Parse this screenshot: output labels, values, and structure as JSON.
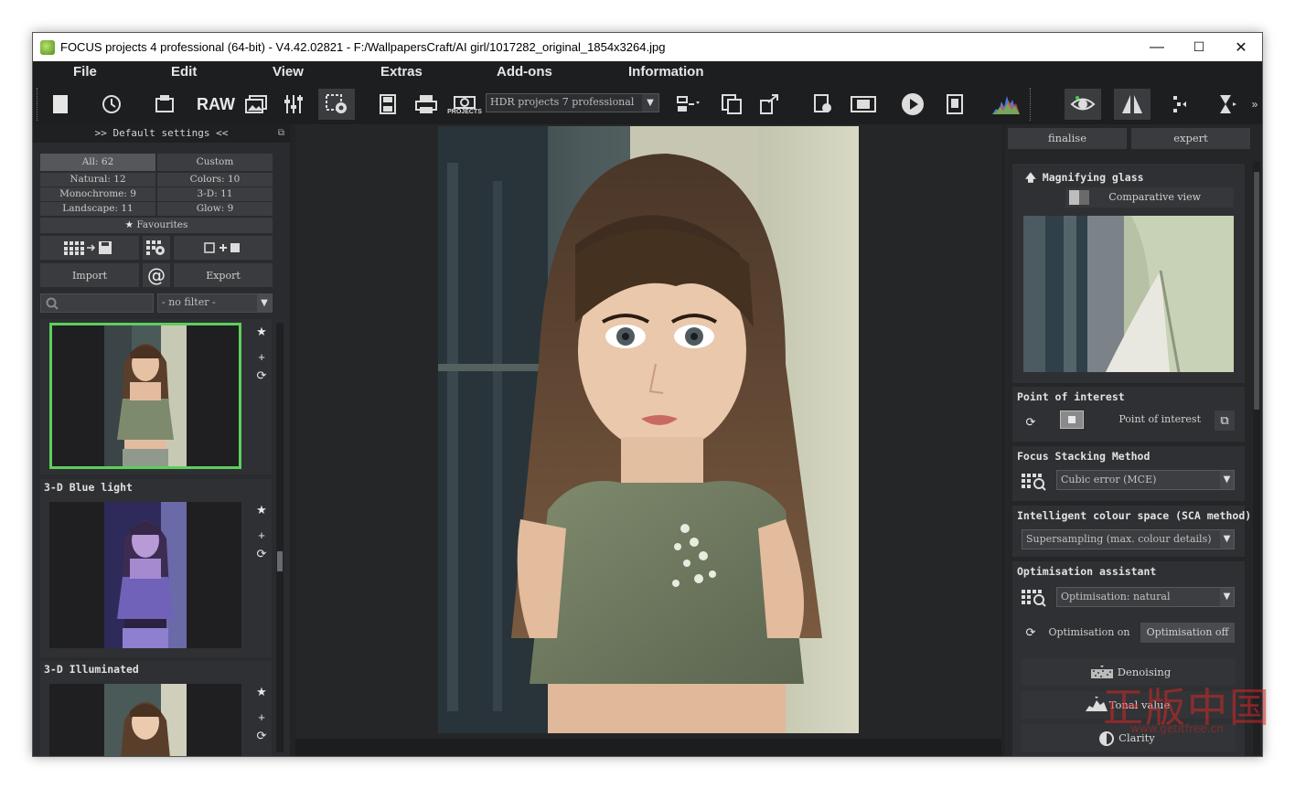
{
  "window": {
    "title": "FOCUS projects 4 professional (64-bit) - V4.42.02821 - F:/WallpapersCraft/AI girl/1017282_original_1854x3264.jpg",
    "minimize": "—",
    "maximize": "☐",
    "close": "✕"
  },
  "menu": [
    "File",
    "Edit",
    "View",
    "Extras",
    "Add-ons",
    "Information"
  ],
  "toolbar": {
    "raw_label": "RAW",
    "projects_label": "PROJECTS",
    "hdr_select": "HDR projects 7 professional",
    "more": "»"
  },
  "left_panel": {
    "header": ">> Default settings <<",
    "pin": "⧉",
    "categories": [
      {
        "label": "All: 62"
      },
      {
        "label": "Custom"
      },
      {
        "label": "Natural: 12"
      },
      {
        "label": "Colors: 10"
      },
      {
        "label": "Monochrome: 9"
      },
      {
        "label": "3-D: 11"
      },
      {
        "label": "Landscape: 11"
      },
      {
        "label": "Glow: 9"
      }
    ],
    "favourites": "Favourites",
    "import": "Import",
    "at_symbol": "@",
    "export": "Export",
    "filter_select": "- no filter -",
    "presets": [
      {
        "title": ""
      },
      {
        "title": "3-D Blue light"
      },
      {
        "title": "3-D Illuminated"
      }
    ]
  },
  "right_panel": {
    "tab_finalise": "finalise",
    "tab_expert": "expert",
    "magnifying_title": "Magnifying glass",
    "comparative_view": "Comparative view",
    "poi_title": "Point of interest",
    "poi_button": "Point of interest",
    "stacking_title": "Focus Stacking Method",
    "stacking_select": "Cubic error (MCE)",
    "colour_space_title": "Intelligent colour space (SCA method)",
    "colour_space_select": "Supersampling (max. colour details)",
    "optimisation_title": "Optimisation assistant",
    "optimisation_select": "Optimisation: natural",
    "optimisation_on": "Optimisation on",
    "optimisation_off": "Optimisation off",
    "denoising": "Denoising",
    "tonal_value": "Tonal value",
    "clarity": "Clarity"
  },
  "watermark": {
    "cn": "正版中国",
    "url": "www.getitfree.cn"
  }
}
